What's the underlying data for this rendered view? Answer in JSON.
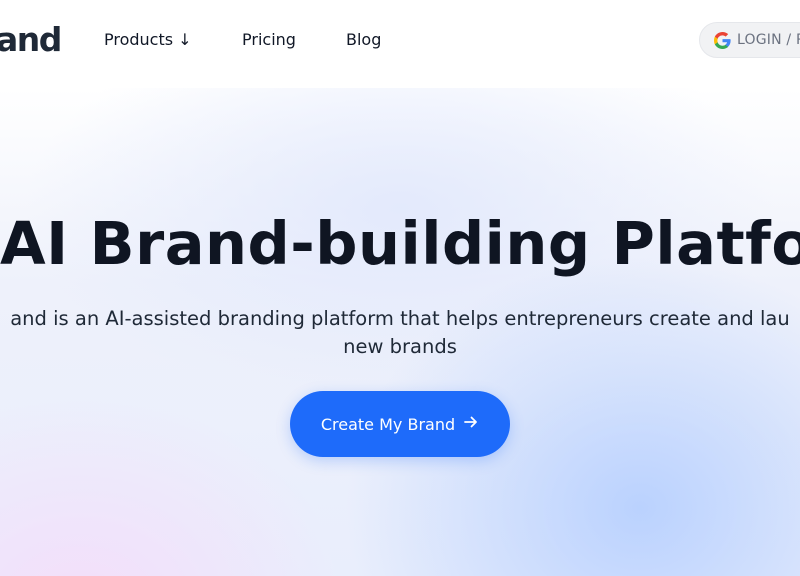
{
  "header": {
    "logo_text": "and",
    "nav": {
      "products_label": "Products ↓",
      "pricing_label": "Pricing",
      "blog_label": "Blog"
    },
    "login": {
      "label": "LOGIN / R",
      "icon": "google-icon"
    }
  },
  "hero": {
    "title": "AI Brand-building Platform",
    "subtitle_line1": "and is an AI-assisted branding platform that helps entrepreneurs create and lau",
    "subtitle_line2": "new brands",
    "cta_label": "Create My Brand",
    "cta_icon": "arrow-right-icon"
  },
  "colors": {
    "accent": "#1e6bfa",
    "text_dark": "#0f1522",
    "login_bg": "#f1f2f4"
  }
}
